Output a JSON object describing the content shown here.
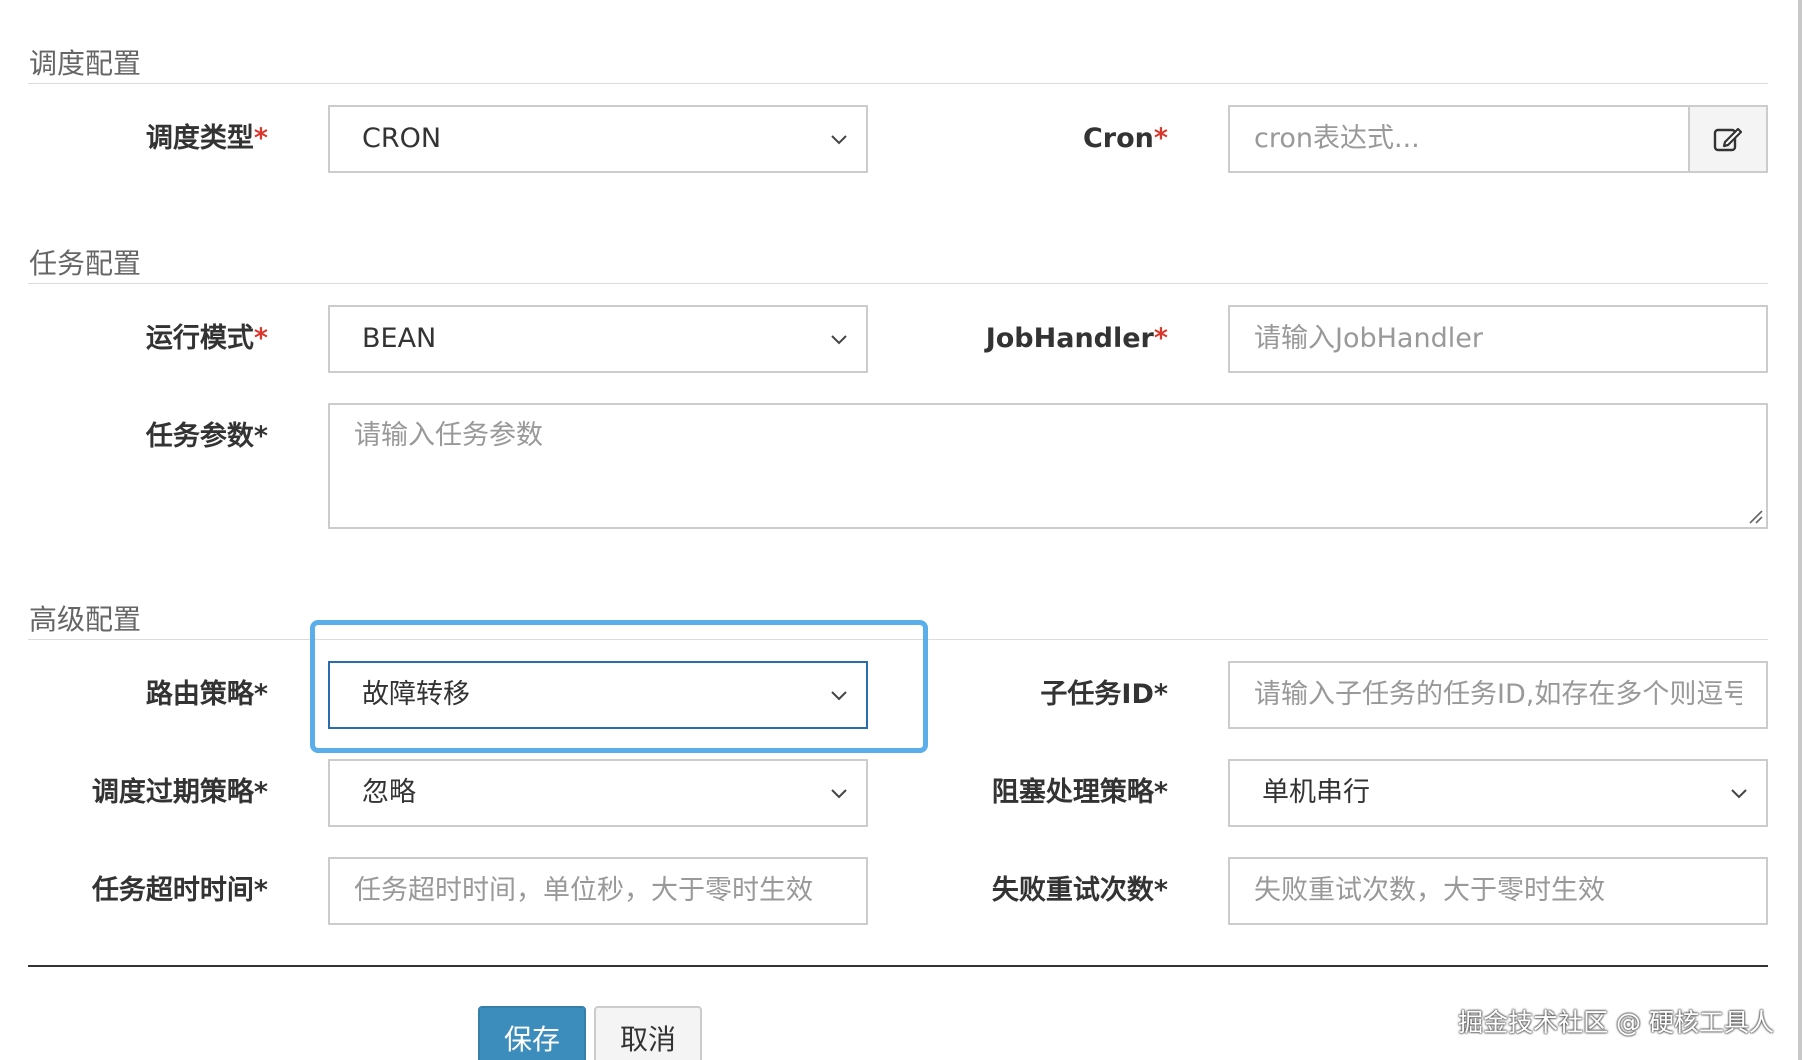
{
  "sections": {
    "schedule": {
      "title": "调度配置",
      "schedule_type": {
        "label": "调度类型",
        "required_mark": "*",
        "value": "CRON"
      },
      "cron": {
        "label": "Cron",
        "required_mark": "*",
        "placeholder": "cron表达式...",
        "edit_icon": "edit-icon"
      }
    },
    "task": {
      "title": "任务配置",
      "run_mode": {
        "label": "运行模式",
        "required_mark": "*",
        "value": "BEAN"
      },
      "job_handler": {
        "label": "JobHandler",
        "required_mark": "*",
        "placeholder": "请输入JobHandler"
      },
      "task_params": {
        "label": "任务参数*",
        "placeholder": "请输入任务参数"
      }
    },
    "advanced": {
      "title": "高级配置",
      "route_strategy": {
        "label": "路由策略*",
        "value": "故障转移"
      },
      "child_job_id": {
        "label": "子任务ID*",
        "placeholder": "请输入子任务的任务ID,如存在多个则逗号分隔"
      },
      "misfire_strategy": {
        "label": "调度过期策略*",
        "value": "忽略"
      },
      "block_strategy": {
        "label": "阻塞处理策略*",
        "value": "单机串行"
      },
      "timeout": {
        "label": "任务超时时间*",
        "placeholder": "任务超时时间，单位秒，大于零时生效"
      },
      "fail_retry": {
        "label": "失败重试次数*",
        "placeholder": "失败重试次数，大于零时生效"
      }
    }
  },
  "buttons": {
    "save": "保存",
    "cancel": "取消"
  },
  "watermark": "掘金技术社区 @ 硬核工具人",
  "colors": {
    "required": "#d9372b",
    "primary": "#3c8dbc",
    "focus_ring": "#5aaeea"
  }
}
